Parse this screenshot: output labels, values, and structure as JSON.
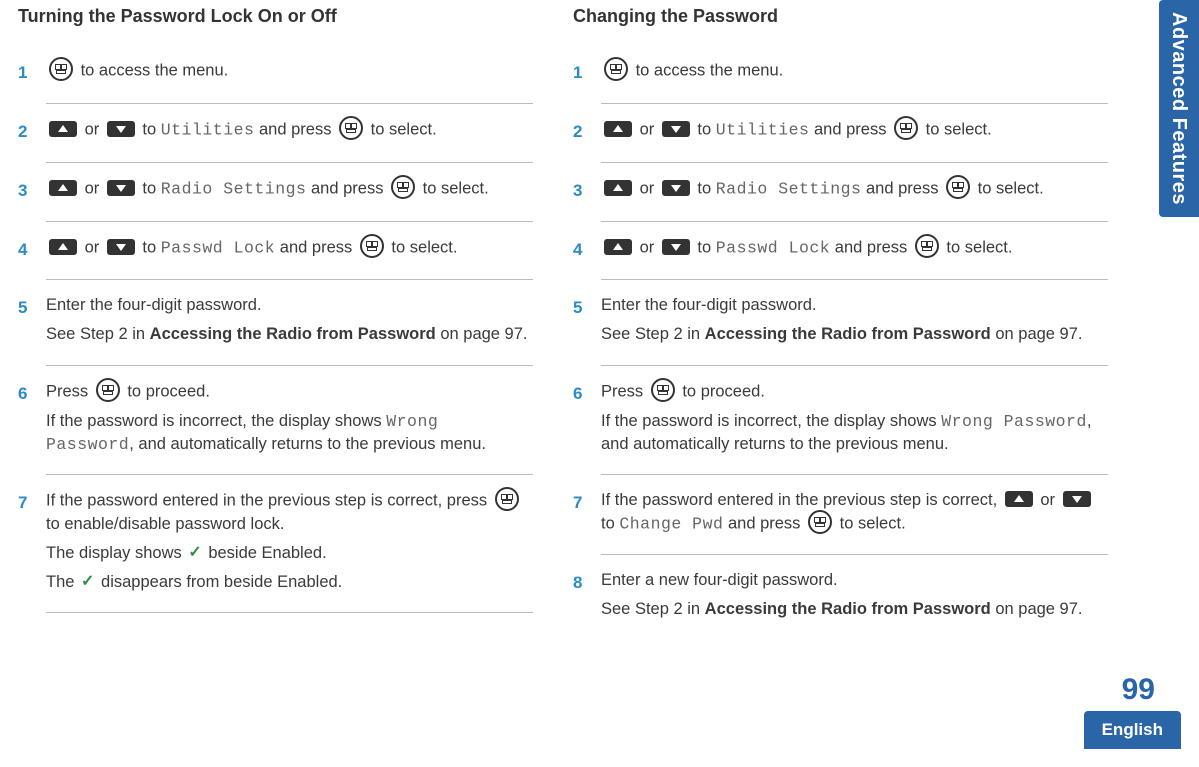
{
  "sidebar": {
    "chapter": "Advanced Features"
  },
  "footer": {
    "page_number": "99",
    "language": "English"
  },
  "left": {
    "title": "Turning the Password Lock On or Off",
    "steps": {
      "s1": {
        "text": " to access the menu."
      },
      "s2": {
        "or": " or ",
        "to": " to ",
        "target": "Utilities",
        "press": " and press ",
        "tail": " to select."
      },
      "s3": {
        "or": " or ",
        "to": " to ",
        "target": "Radio Settings",
        "press": " and press ",
        "tail": " to select."
      },
      "s4": {
        "or": " or ",
        "to": " to ",
        "target": "Passwd Lock",
        "press": " and press ",
        "tail": " to select."
      },
      "s5": {
        "p1": "Enter the four-digit password.",
        "p2a": "See Step 2 in ",
        "p2b": "Accessing the Radio from Password",
        "p2c": " on page 97."
      },
      "s6": {
        "p1a": "Press ",
        "p1b": " to proceed.",
        "p2a": "If the password is incorrect, the display shows ",
        "p2b": "Wrong Password",
        "p2c": ", and automatically returns to the previous menu."
      },
      "s7": {
        "p1a": "If the password entered in the previous step is correct, press ",
        "p1b": " to enable/disable password lock.",
        "p2a": "The display shows ",
        "p2b": " beside Enabled.",
        "p3a": "The ",
        "p3b": " disappears from beside Enabled."
      }
    }
  },
  "right": {
    "title": "Changing the Password",
    "steps": {
      "s1": {
        "text": " to access the menu."
      },
      "s2": {
        "or": " or ",
        "to": " to ",
        "target": "Utilities",
        "press": " and press ",
        "tail": " to select."
      },
      "s3": {
        "or": " or ",
        "to": " to ",
        "target": "Radio Settings",
        "press": " and press ",
        "tail": " to select."
      },
      "s4": {
        "or": " or ",
        "to": " to ",
        "target": "Passwd Lock",
        "press": " and press ",
        "tail": " to select."
      },
      "s5": {
        "p1": "Enter the four-digit password.",
        "p2a": "See Step 2 in ",
        "p2b": "Accessing the Radio from Password",
        "p2c": " on page 97."
      },
      "s6": {
        "p1a": "Press ",
        "p1b": " to proceed.",
        "p2a": "If the password is incorrect, the display shows ",
        "p2b": "Wrong Password",
        "p2c": ", and automatically returns to the previous menu."
      },
      "s7": {
        "p1a": "If the password entered in the previous step is correct, ",
        "or": " or ",
        "to": " to ",
        "target": "Change Pwd",
        "press": " and press ",
        "tail": " to select."
      },
      "s8": {
        "p1": "Enter a new four-digit password.",
        "p2a": "See Step 2 in ",
        "p2b": "Accessing the Radio from Password",
        "p2c": " on page 97."
      }
    }
  }
}
